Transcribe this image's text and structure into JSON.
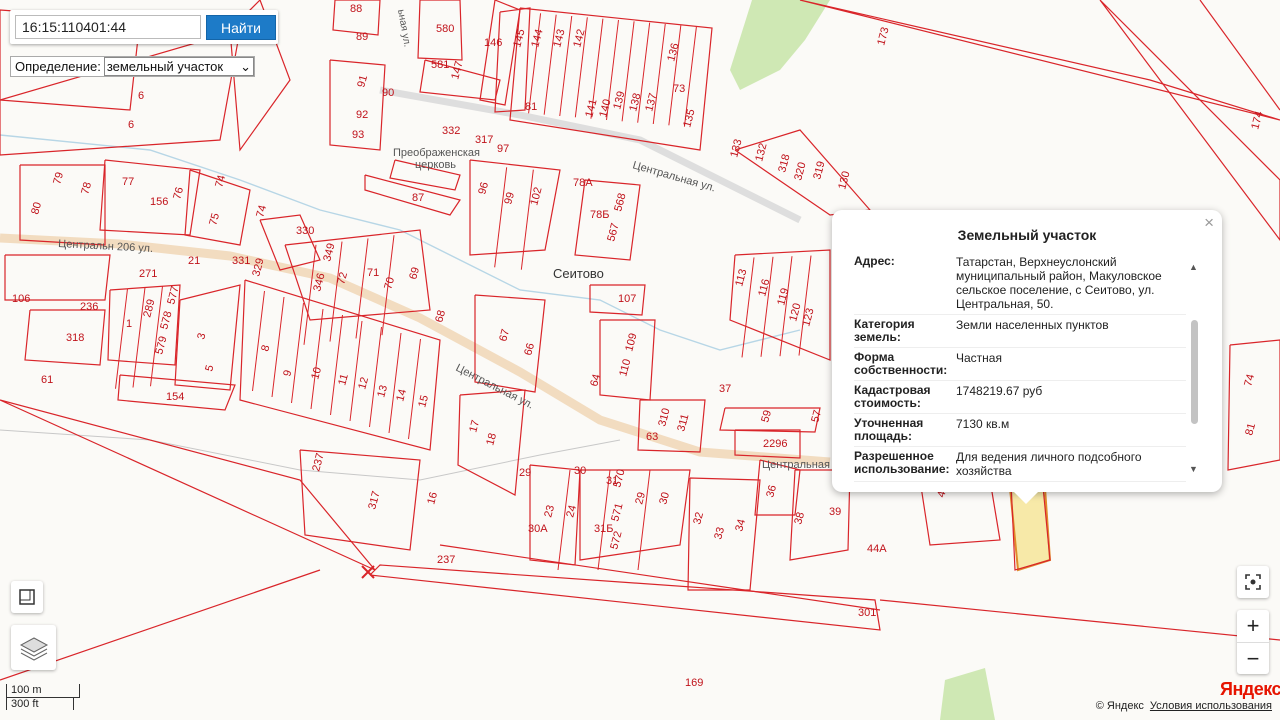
{
  "search": {
    "value": "16:15:110401:44",
    "button": "Найти"
  },
  "definition": {
    "label": "Определение:",
    "selected": "земельный участок"
  },
  "map_labels": {
    "village": "Сеитово",
    "church": [
      "Преображенская",
      "церковь"
    ],
    "streets": [
      "Центральн 206 ул.",
      "Центральная ул.",
      "Центральная ул.",
      "Центральная",
      "ьная ул."
    ]
  },
  "parcels": [
    "88",
    "89",
    "580",
    "146",
    "145",
    "144",
    "143",
    "142",
    "141",
    "140",
    "139",
    "138",
    "137",
    "136",
    "135",
    "173",
    "174",
    "581",
    "147",
    "91",
    "92",
    "93",
    "90",
    "332",
    "317",
    "97",
    "6",
    "6",
    "79",
    "78",
    "77",
    "156",
    "76",
    "74",
    "75",
    "74",
    "80",
    "330",
    "349",
    "71",
    "70",
    "69",
    "346",
    "72",
    "96",
    "99",
    "102",
    "78А",
    "568",
    "567",
    "133",
    "132",
    "318",
    "320",
    "319",
    "130",
    "236",
    "271",
    "331",
    "329",
    "318",
    "1",
    "289",
    "578",
    "577",
    "579",
    "3",
    "5",
    "8",
    "9",
    "10",
    "11",
    "12",
    "13",
    "14",
    "15",
    "68",
    "67",
    "66",
    "107",
    "109",
    "110",
    "64",
    "113",
    "116",
    "119",
    "120",
    "123",
    "154",
    "63",
    "310",
    "311",
    "59",
    "2296",
    "57",
    "17",
    "18",
    "237",
    "317",
    "16",
    "23",
    "24",
    "570",
    "571",
    "572",
    "29",
    "30",
    "32",
    "33",
    "34",
    "36",
    "38",
    "39",
    "44",
    "44А",
    "237",
    "301",
    "169",
    "74",
    "81",
    "61",
    "106",
    "37",
    "78Б",
    "87",
    "30А",
    "31Б",
    "29",
    "30",
    "31",
    "73",
    "81",
    "21"
  ],
  "popup": {
    "title": "Земельный участок",
    "close": "×",
    "rows": [
      {
        "label": "Адрес:",
        "value": "Татарстан, Верхнеуслонский муниципальный район, Макуловское сельское поселение, с Сеитово, ул. Центральная, 50."
      },
      {
        "label": "Категория земель:",
        "value": "Земли населенных пунктов"
      },
      {
        "label": "Форма собственности:",
        "value": "Частная"
      },
      {
        "label": "Кадастровая стоимость:",
        "value": "1748219.67 руб"
      },
      {
        "label": "Уточненная площадь:",
        "value": "7130 кв.м"
      },
      {
        "label": "Разрешенное использование:",
        "value": "Для ведения личного подсобного хозяйства"
      }
    ]
  },
  "controls": {
    "zoom_in": "+",
    "zoom_out": "−"
  },
  "scale": {
    "metric": "100 m",
    "imperial": "300 ft"
  },
  "footer": {
    "copyright": "© Яндекс",
    "terms": "Условия использования",
    "logo": "Яндекс"
  },
  "colors": {
    "parcel": "#d9252a",
    "highlight": "#f7e9a8",
    "button": "#1d7bc8",
    "road": "#f2dcc0"
  }
}
